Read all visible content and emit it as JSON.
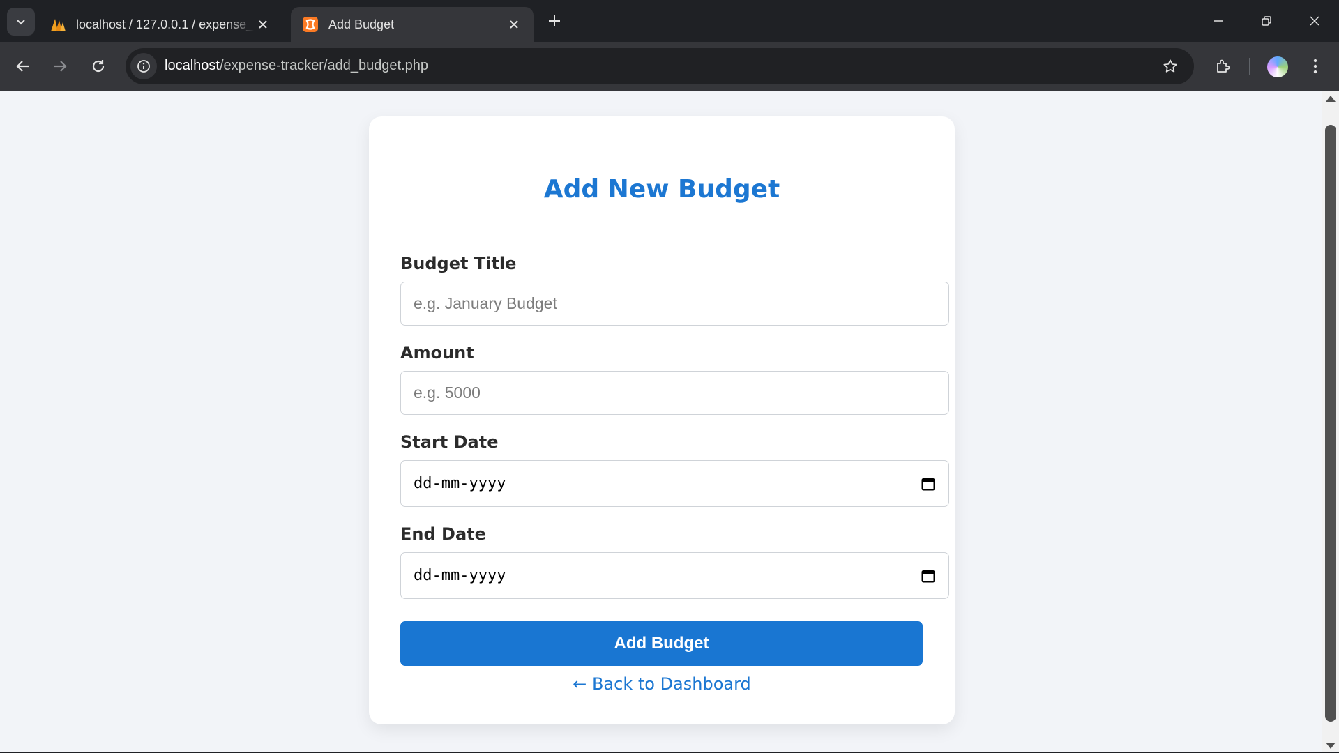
{
  "browser": {
    "tabs": [
      {
        "title": "localhost / 127.0.0.1 / expense_",
        "icon": "phpmyadmin-icon",
        "active": false
      },
      {
        "title": "Add Budget",
        "icon": "xampp-icon",
        "active": true
      }
    ],
    "url_host": "localhost",
    "url_path": "/expense-tracker/add_budget.php"
  },
  "form": {
    "heading": "Add New Budget",
    "fields": [
      {
        "label": "Budget Title",
        "placeholder": "e.g. January Budget",
        "type": "text"
      },
      {
        "label": "Amount",
        "placeholder": "e.g. 5000",
        "type": "number"
      },
      {
        "label": "Start Date",
        "placeholder": "dd-mm-yyyy",
        "type": "date"
      },
      {
        "label": "End Date",
        "placeholder": "dd-mm-yyyy",
        "type": "date"
      }
    ],
    "submit_label": "Add Budget",
    "back_link": "← Back to Dashboard"
  },
  "colors": {
    "accent": "#1976d2",
    "heading": "#1c77d2",
    "page_bg": "#f2f4f8"
  }
}
